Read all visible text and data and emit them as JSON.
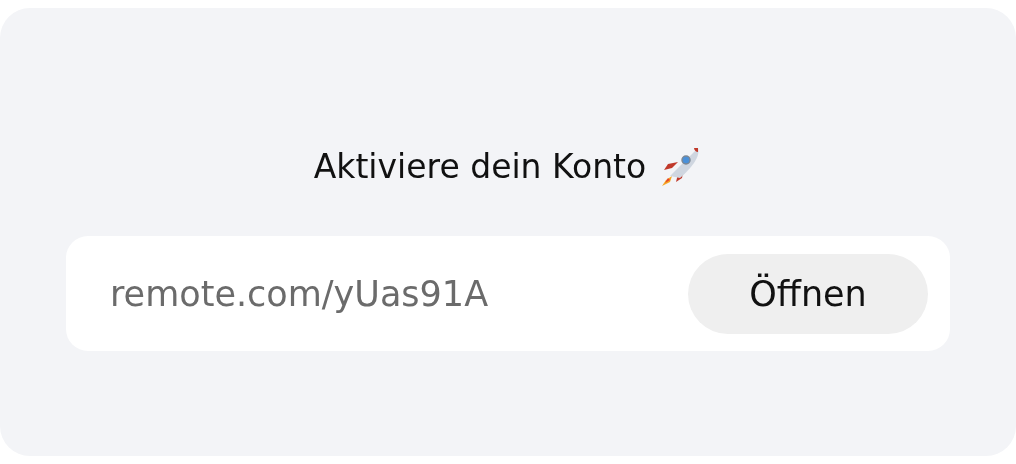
{
  "title": "Aktiviere dein Konto",
  "link": {
    "url": "remote.com/yUas91A",
    "button": "Öffnen"
  }
}
